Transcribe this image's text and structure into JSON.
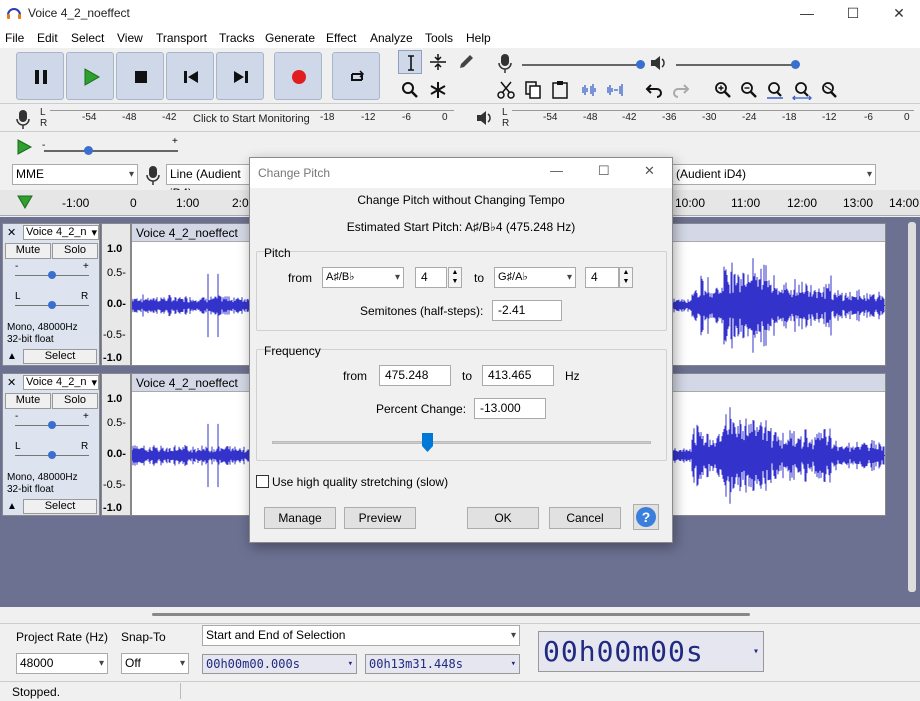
{
  "window": {
    "title": "Voice 4_2_noeffect",
    "minimize": "—",
    "maximize": "☐",
    "close": "✕"
  },
  "menu": [
    "File",
    "Edit",
    "Select",
    "View",
    "Transport",
    "Tracks",
    "Generate",
    "Effect",
    "Analyze",
    "Tools",
    "Help"
  ],
  "meter": {
    "rec_ticks": [
      "-54",
      "-48",
      "-42",
      "-18",
      "-12",
      "-6",
      "0"
    ],
    "monitor_hint": "Click to Start Monitoring",
    "play_ticks": [
      "-54",
      "-48",
      "-42",
      "-36",
      "-30",
      "-24",
      "-18",
      "-12",
      "-6",
      "0"
    ],
    "lr": [
      "L",
      "R"
    ]
  },
  "device": {
    "host": "MME",
    "rec_device": "Line (Audient iD4)",
    "play_device": "(Audient iD4)"
  },
  "timeline": {
    "ticks": [
      "-1:00",
      "0",
      "1:00",
      "2:0",
      "10:00",
      "11:00",
      "12:00",
      "13:00",
      "14:00"
    ]
  },
  "tracks": [
    {
      "name": "Voice 4_2_n",
      "clip": "Voice 4_2_noeffect",
      "mute": "Mute",
      "solo": "Solo",
      "info1": "Mono, 48000Hz",
      "info2": "32-bit float",
      "select": "Select",
      "scale": [
        "1.0",
        "0.5-",
        "0.0-",
        "-0.5-",
        "-1.0"
      ],
      "gain_minus": "-",
      "gain_plus": "+",
      "pan_l": "L",
      "pan_r": "R"
    },
    {
      "name": "Voice 4_2_n",
      "clip": "Voice 4_2_noeffect",
      "mute": "Mute",
      "solo": "Solo",
      "info1": "Mono, 48000Hz",
      "info2": "32-bit float",
      "select": "Select",
      "scale": [
        "1.0",
        "0.5-",
        "0.0-",
        "-0.5-",
        "-1.0"
      ],
      "gain_minus": "-",
      "gain_plus": "+",
      "pan_l": "L",
      "pan_r": "R"
    }
  ],
  "dialog": {
    "title": "Change Pitch",
    "heading": "Change Pitch without Changing Tempo",
    "estimate": "Estimated Start Pitch: A♯/B♭4 (475.248 Hz)",
    "pitch_group": "Pitch",
    "from_label": "from",
    "from_note": "A♯/B♭",
    "from_octave": "4",
    "to_label": "to",
    "to_note": "G♯/A♭",
    "to_octave": "4",
    "semitones_label": "Semitones (half-steps):",
    "semitones": "-2.41",
    "freq_group": "Frequency",
    "freq_from_label": "from",
    "freq_from": "475.248",
    "freq_to_label": "to",
    "freq_to": "413.465",
    "hz": "Hz",
    "percent_label": "Percent Change:",
    "percent": "-13.000",
    "slider_position": 0.41,
    "hq_label": "Use high quality stretching (slow)",
    "hq_checked": false,
    "manage": "Manage",
    "preview": "Preview",
    "ok": "OK",
    "cancel": "Cancel",
    "help": "?"
  },
  "selection_bar": {
    "rate_label": "Project Rate (Hz)",
    "rate": "48000",
    "snap_label": "Snap-To",
    "snap": "Off",
    "mode": "Start and End of Selection",
    "start": "00h00m00.000s",
    "end": "00h13m31.448s",
    "audio_pos": "00h00m00s"
  },
  "status": "Stopped.",
  "colors": {
    "wave": "#3333cc",
    "accent": "#0078d7",
    "play": "#2ea02e",
    "record": "#e01e1e"
  }
}
